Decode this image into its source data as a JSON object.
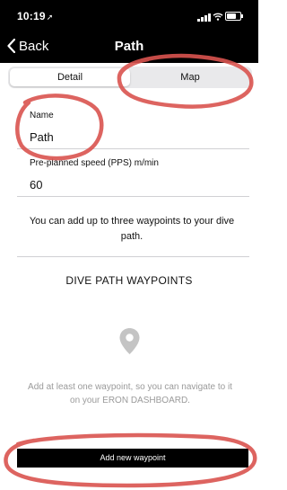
{
  "status_bar": {
    "time": "10:19",
    "location_glyph": "➚"
  },
  "nav": {
    "back_label": "Back",
    "title": "Path"
  },
  "segments": [
    {
      "label": "Detail",
      "selected": true
    },
    {
      "label": "Map",
      "selected": false
    }
  ],
  "form": {
    "name": {
      "label": "Name",
      "value": "Path"
    },
    "speed": {
      "label": "Pre-planned speed (PPS) m/min",
      "value": "60"
    }
  },
  "info_text": "You can add up to three waypoints to your dive path.",
  "waypoints": {
    "section_title": "DIVE PATH WAYPOINTS",
    "empty_message": "Add at least one waypoint, so you can navigate to it on your ERON DASHBOARD.",
    "add_button_label": "Add new waypoint"
  },
  "colors": {
    "bar": "#000000",
    "segment_track": "#e9e9eb",
    "annotation": "#d9534f",
    "placeholder_text": "#9a9a9a",
    "pin": "#c4c4c4"
  },
  "icons": [
    "back-chevron-icon",
    "location-arrow-icon",
    "signal-icon",
    "wifi-icon",
    "battery-icon",
    "location-pin-icon"
  ]
}
